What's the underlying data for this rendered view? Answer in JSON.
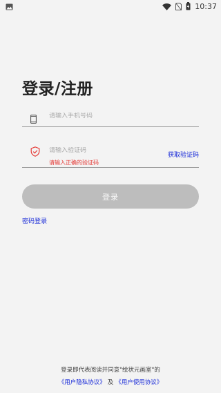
{
  "status_bar": {
    "time": "10:37",
    "icons": [
      "image-icon",
      "wifi-icon",
      "no-sim-icon",
      "battery-charging-icon"
    ]
  },
  "login": {
    "title": "登录/注册",
    "phone_placeholder": "请输入手机号码",
    "code_placeholder": "请输入验证码",
    "code_error": "请输入正确的验证码",
    "get_code_label": "获取验证码",
    "submit_label": "登录",
    "password_login_label": "密码登录"
  },
  "footer": {
    "consent_text": "登录即代表阅读并同意\"绘状元画室\"的",
    "user_privacy_link": "《用户隐私协议》",
    "and_text": "及",
    "user_terms_link": "《用户使用协议》"
  },
  "colors": {
    "background": "#f3f3f3",
    "link": "#1a2bd8",
    "error": "#e53935",
    "button_disabled": "#bdbdbd"
  }
}
